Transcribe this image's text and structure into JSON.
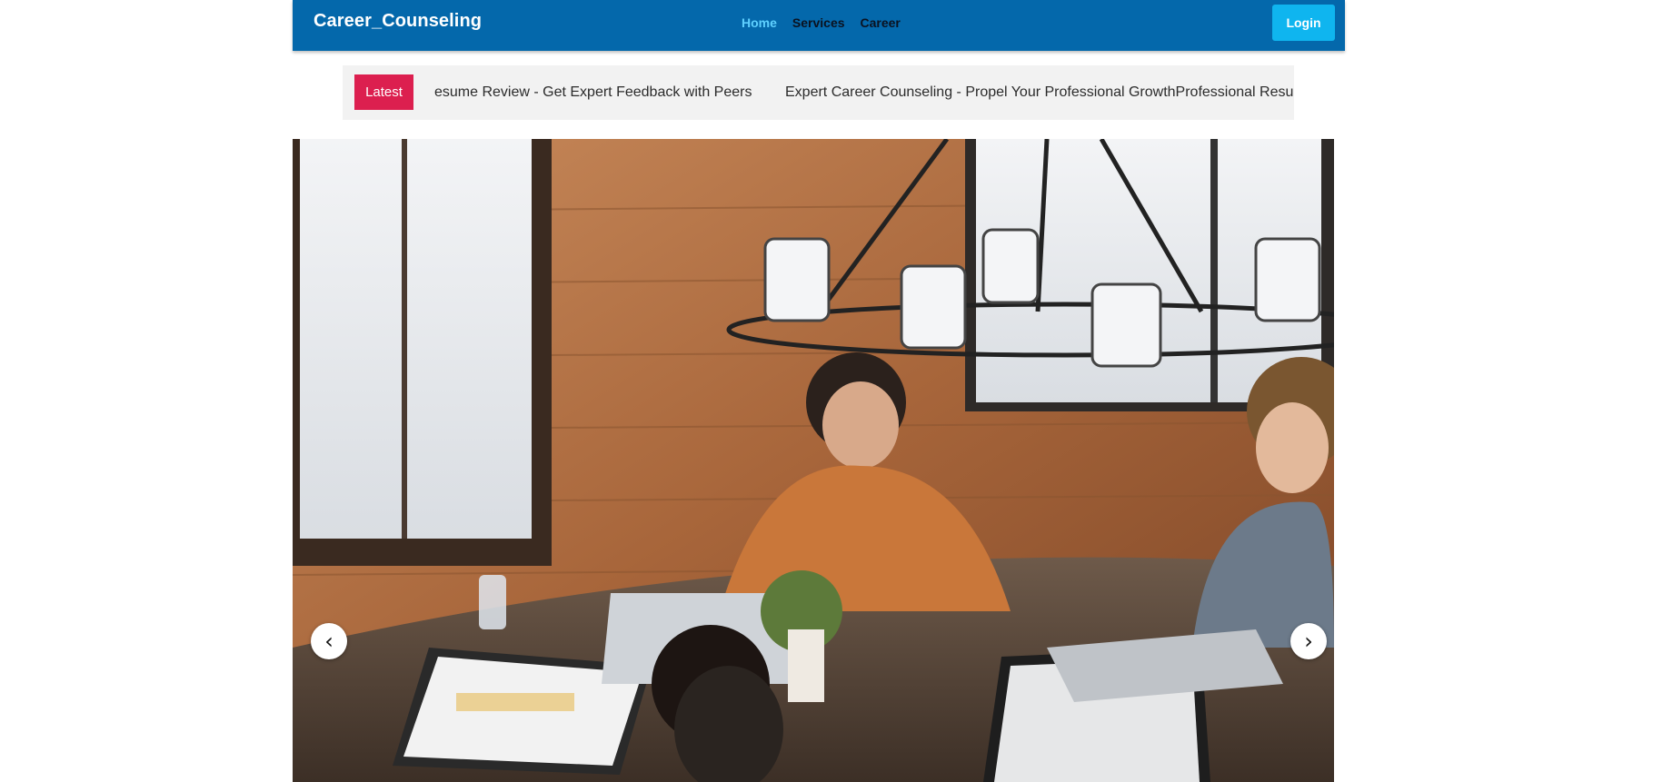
{
  "navbar": {
    "brand": "Career_Counseling",
    "links": [
      "Home",
      "Services",
      "Career"
    ],
    "active_link": "Home",
    "login_label": "Login",
    "colors": {
      "background": "#0468ab",
      "active": "#5fd0ff",
      "login_bg": "#0fb5ef"
    }
  },
  "ticker": {
    "badge": "Latest",
    "items": [
      "esume Review - Get Expert Feedback with Peers",
      "Expert Career Counseling - Propel Your Professional GrowthProfessional Resum"
    ],
    "colors": {
      "badge_bg": "#dc1f4f"
    }
  },
  "hero": {
    "image_icon": "team-meeting-photo",
    "prev_label": "‹",
    "next_label": "›"
  }
}
